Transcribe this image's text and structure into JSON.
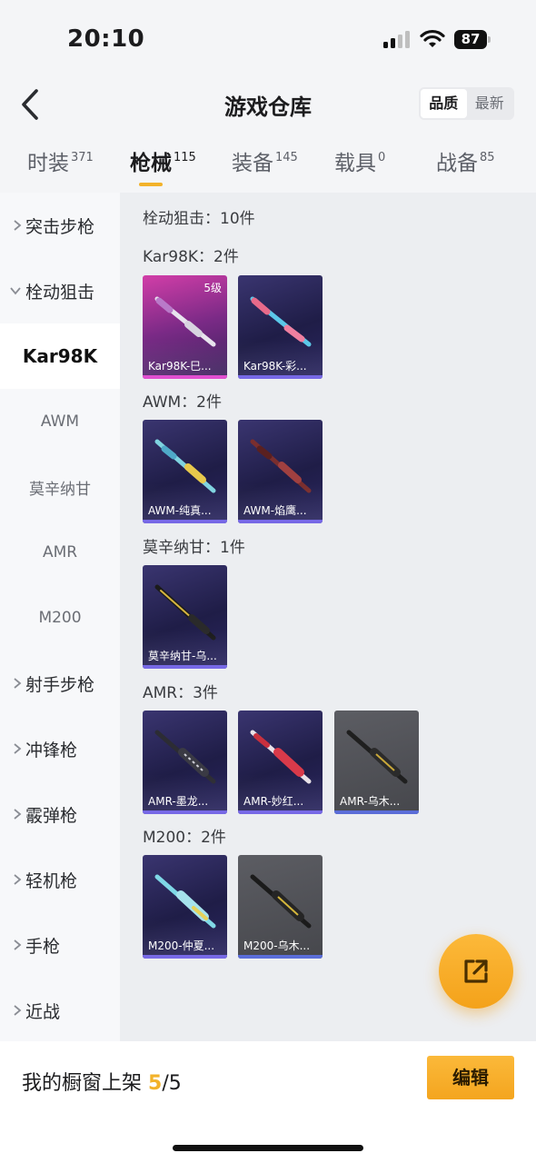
{
  "status_bar": {
    "time": "20:10",
    "battery": "87"
  },
  "nav": {
    "title": "游戏仓库",
    "sort_options": [
      "品质",
      "最新"
    ]
  },
  "tabs": [
    {
      "label": "时装",
      "count": "371"
    },
    {
      "label": "枪械",
      "count": "115"
    },
    {
      "label": "装备",
      "count": "145"
    },
    {
      "label": "载具",
      "count": "0"
    },
    {
      "label": "战备",
      "count": "85"
    }
  ],
  "sidebar": {
    "categories": [
      "突击步枪",
      "栓动狙击",
      "射手步枪",
      "冲锋枪",
      "霰弹枪",
      "轻机枪",
      "手枪",
      "近战"
    ],
    "subcategories": [
      "Kar98K",
      "AWM",
      "莫辛纳甘",
      "AMR",
      "M200"
    ]
  },
  "content": {
    "header": "栓动狙击：10件",
    "groups": [
      {
        "title": "Kar98K：2件",
        "items": [
          {
            "name": "Kar98K-巳...",
            "level": "5级",
            "rarity": "pink"
          },
          {
            "name": "Kar98K-彩...",
            "rarity": "purple"
          }
        ]
      },
      {
        "title": "AWM：2件",
        "items": [
          {
            "name": "AWM-纯真...",
            "rarity": "purple"
          },
          {
            "name": "AWM-焰鹰...",
            "rarity": "purple"
          }
        ]
      },
      {
        "title": "莫辛纳甘：1件",
        "items": [
          {
            "name": "莫辛纳甘-乌...",
            "rarity": "purple"
          }
        ]
      },
      {
        "title": "AMR：3件",
        "items": [
          {
            "name": "AMR-墨龙...",
            "rarity": "purple"
          },
          {
            "name": "AMR-妙红...",
            "rarity": "purple"
          },
          {
            "name": "AMR-乌木...",
            "rarity": "grey"
          }
        ]
      },
      {
        "title": "M200：2件",
        "items": [
          {
            "name": "M200-仲夏...",
            "rarity": "purple"
          },
          {
            "name": "M200-乌木...",
            "rarity": "grey"
          }
        ]
      }
    ]
  },
  "bottom": {
    "shelf_label": "我的橱窗上架",
    "shelf_current": "5",
    "shelf_total": "/5",
    "edit_label": "编辑"
  },
  "colors": {
    "accent": "#f2b22a",
    "rare_purple": "#7769e6",
    "rare_pink": "#e14fd0"
  }
}
